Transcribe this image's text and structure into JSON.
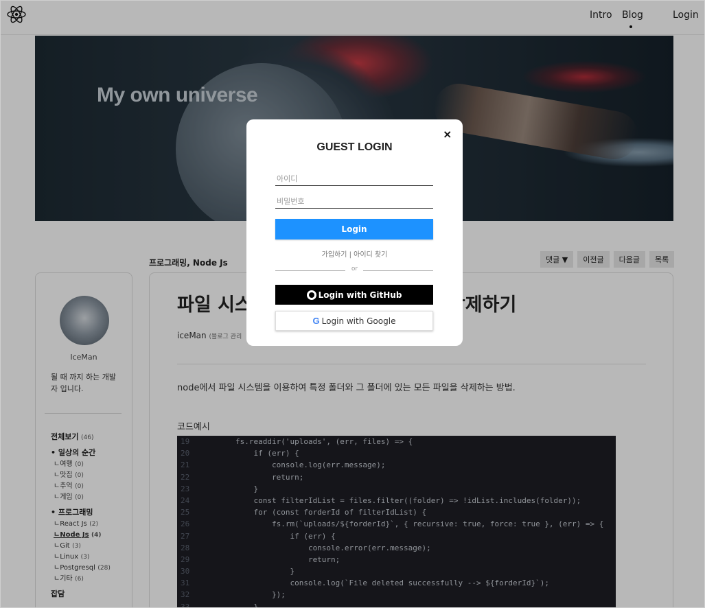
{
  "nav": {
    "intro": "Intro",
    "blog": "Blog",
    "login": "Login"
  },
  "hero": {
    "title": "My own universe"
  },
  "post": {
    "category": "프로그래밍, Node Js",
    "actions": [
      "댓글 ▼",
      "이전글",
      "다음글",
      "목록"
    ],
    "title_left": "파일 시스",
    "title_right": "파일 모두 삭제하기",
    "author": "iceMan",
    "author_role": "(블로그 관리",
    "description": "node에서 파일 시스템을 이용하여 특정 폴더와 그 폴더에 있는 모든 파일을 삭제하는 방법.",
    "code_label": "코드예시"
  },
  "sidebar": {
    "name": "IceMan",
    "desc": "될 때 까지 하는 개발자 입니다.",
    "categories": [
      {
        "label": "전체보기",
        "count": "(46)",
        "level": "top"
      },
      {
        "label": "• 일상의 순간",
        "count": "",
        "level": "group"
      },
      {
        "label": "ㄴ여행",
        "count": "(0)",
        "level": "sub"
      },
      {
        "label": "ㄴ맛집",
        "count": "(0)",
        "level": "sub"
      },
      {
        "label": "ㄴ추억",
        "count": "(0)",
        "level": "sub"
      },
      {
        "label": "ㄴ게임",
        "count": "(0)",
        "level": "sub"
      },
      {
        "label": "• 프로그래밍",
        "count": "",
        "level": "group"
      },
      {
        "label": "ㄴReact Js",
        "count": "(2)",
        "level": "sub"
      },
      {
        "label": "ㄴNode Js",
        "count": "(4)",
        "level": "sub-active"
      },
      {
        "label": "ㄴGit",
        "count": "(3)",
        "level": "sub"
      },
      {
        "label": "ㄴLinux",
        "count": "(3)",
        "level": "sub"
      },
      {
        "label": "ㄴPostgresql",
        "count": "(28)",
        "level": "sub"
      },
      {
        "label": "ㄴ기타",
        "count": "(6)",
        "level": "sub"
      },
      {
        "label": "잡담",
        "count": "",
        "level": "top"
      }
    ]
  },
  "code": [
    {
      "no": "19",
      "text": "        fs.readdir('uploads', (err, files) => {"
    },
    {
      "no": "20",
      "text": "            if (err) {"
    },
    {
      "no": "21",
      "text": "                console.log(err.message);"
    },
    {
      "no": "22",
      "text": "                return;"
    },
    {
      "no": "23",
      "text": "            }"
    },
    {
      "no": "24",
      "text": "            const filterIdList = files.filter((folder) => !idList.includes(folder));"
    },
    {
      "no": "25",
      "text": "            for (const forderId of filterIdList) {"
    },
    {
      "no": "26",
      "text": "                fs.rm(`uploads/${forderId}`, { recursive: true, force: true }, (err) => {"
    },
    {
      "no": "27",
      "text": "                    if (err) {"
    },
    {
      "no": "28",
      "text": "                        console.error(err.message);"
    },
    {
      "no": "29",
      "text": "                        return;"
    },
    {
      "no": "30",
      "text": "                    }"
    },
    {
      "no": "31",
      "text": "                    console.log(`File deleted successfully --> ${forderId}`);"
    },
    {
      "no": "32",
      "text": "                });"
    },
    {
      "no": "33",
      "text": "            }"
    }
  ],
  "modal": {
    "title": "GUEST LOGIN",
    "id_placeholder": "아이디",
    "pw_placeholder": "비밀번호",
    "login": "Login",
    "signup": "가입하기",
    "separator": " | ",
    "find_id": "아이디 찾기",
    "or": "or",
    "github": "Login with GitHub",
    "google": "Login with Google",
    "close": "×"
  }
}
